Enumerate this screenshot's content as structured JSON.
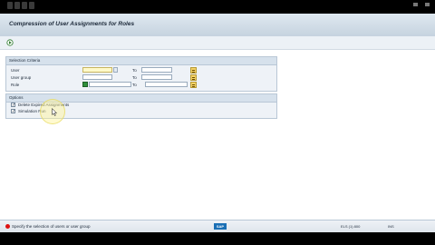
{
  "page": {
    "title": "Compression of User Assignments for Roles"
  },
  "selection": {
    "header": "Selection Criteria",
    "rows": [
      {
        "label": "User",
        "from": "",
        "to_label": "To",
        "to": ""
      },
      {
        "label": "User group",
        "from": "",
        "to_label": "To",
        "to": ""
      },
      {
        "label": "Role",
        "from": "",
        "to_label": "To",
        "to": ""
      }
    ]
  },
  "options": {
    "header": "Options",
    "items": [
      {
        "label": "Delete Expired Assignments",
        "checked": true
      },
      {
        "label": "Simulation Run",
        "checked": true
      }
    ]
  },
  "status": {
    "message": "Specify the selection of users or user group",
    "system": "ELS (1) 800",
    "mode": "INS"
  },
  "icons": {
    "execute": "execute-icon",
    "status": "error-icon",
    "multiple_selection": "multiple-selection-icon"
  },
  "colors": {
    "required_field": "#fff9c9",
    "multi_button": "#f4d266",
    "group_header": "#d6e1ec",
    "error": "#dd1111"
  }
}
